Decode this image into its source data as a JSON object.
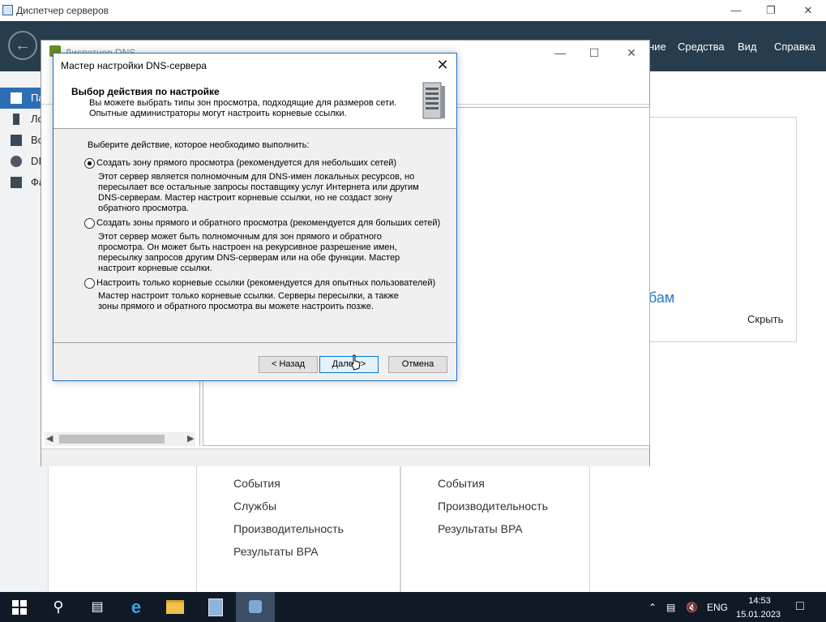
{
  "server_manager": {
    "title": "Диспетчер серверов",
    "menu": [
      "ние",
      "Средства",
      "Вид",
      "Справка"
    ],
    "sidebar": [
      {
        "label": "Па"
      },
      {
        "label": "Ло"
      },
      {
        "label": "Вс"
      },
      {
        "label": "DI"
      },
      {
        "label": "Фа"
      }
    ],
    "card_link": "бам",
    "card_hide": "Скрыть",
    "tiles": [
      {
        "items": [
          "События",
          "Службы",
          "Производительность",
          "Результаты BPA"
        ]
      },
      {
        "items": [
          "События",
          "Производительность",
          "Результаты BPA"
        ]
      }
    ]
  },
  "dns_manager": {
    "title": "Диспетчер DNS"
  },
  "wizard": {
    "title": "Мастер настройки DNS-сервера",
    "heading": "Выбор действия по настройке",
    "subtitle_line1": "Вы можете выбрать типы зон просмотра, подходящие для размеров сети.",
    "subtitle_line2": "Опытные администраторы могут настроить корневые ссылки.",
    "prompt": "Выберите действие, которое необходимо выполнить:",
    "options": [
      {
        "label": "Создать зону прямого просмотра (рекомендуется для небольших сетей)",
        "selected": true,
        "desc": [
          "Этот сервер является полномочным для DNS-имен локальных ресурсов, но",
          "пересылает все остальные запросы поставщику услуг Интернета или другим",
          "DNS-серверам. Мастер настроит корневые ссылки, но не создаст зону",
          "обратного просмотра."
        ]
      },
      {
        "label": "Создать зоны прямого и обратного просмотра (рекомендуется для больших сетей)",
        "selected": false,
        "desc": [
          "Этот сервер может быть полномочным для зон прямого и обратного",
          "просмотра. Он может быть настроен на рекурсивное разрешение имен,",
          "пересылку запросов другим DNS-серверам или на обе функции. Мастер",
          "настроит корневые ссылки."
        ]
      },
      {
        "label": "Настроить только корневые ссылки (рекомендуется для опытных пользователей)",
        "selected": false,
        "desc": [
          "Мастер настроит только корневые ссылки. Серверы пересылки, а также",
          "зоны прямого и обратного просмотра вы можете настроить позже."
        ]
      }
    ],
    "buttons": {
      "back": "< Назад",
      "next": "Далее >",
      "cancel": "Отмена"
    }
  },
  "taskbar": {
    "lang": "ENG",
    "time": "14:53",
    "date": "15.01.2023"
  },
  "colors": {
    "sm_header": "#273d4d",
    "sidebar_active": "#2d6fb6",
    "wizard_border": "#1c73c8",
    "taskbar": "#101a26",
    "link": "#2b79c2"
  }
}
